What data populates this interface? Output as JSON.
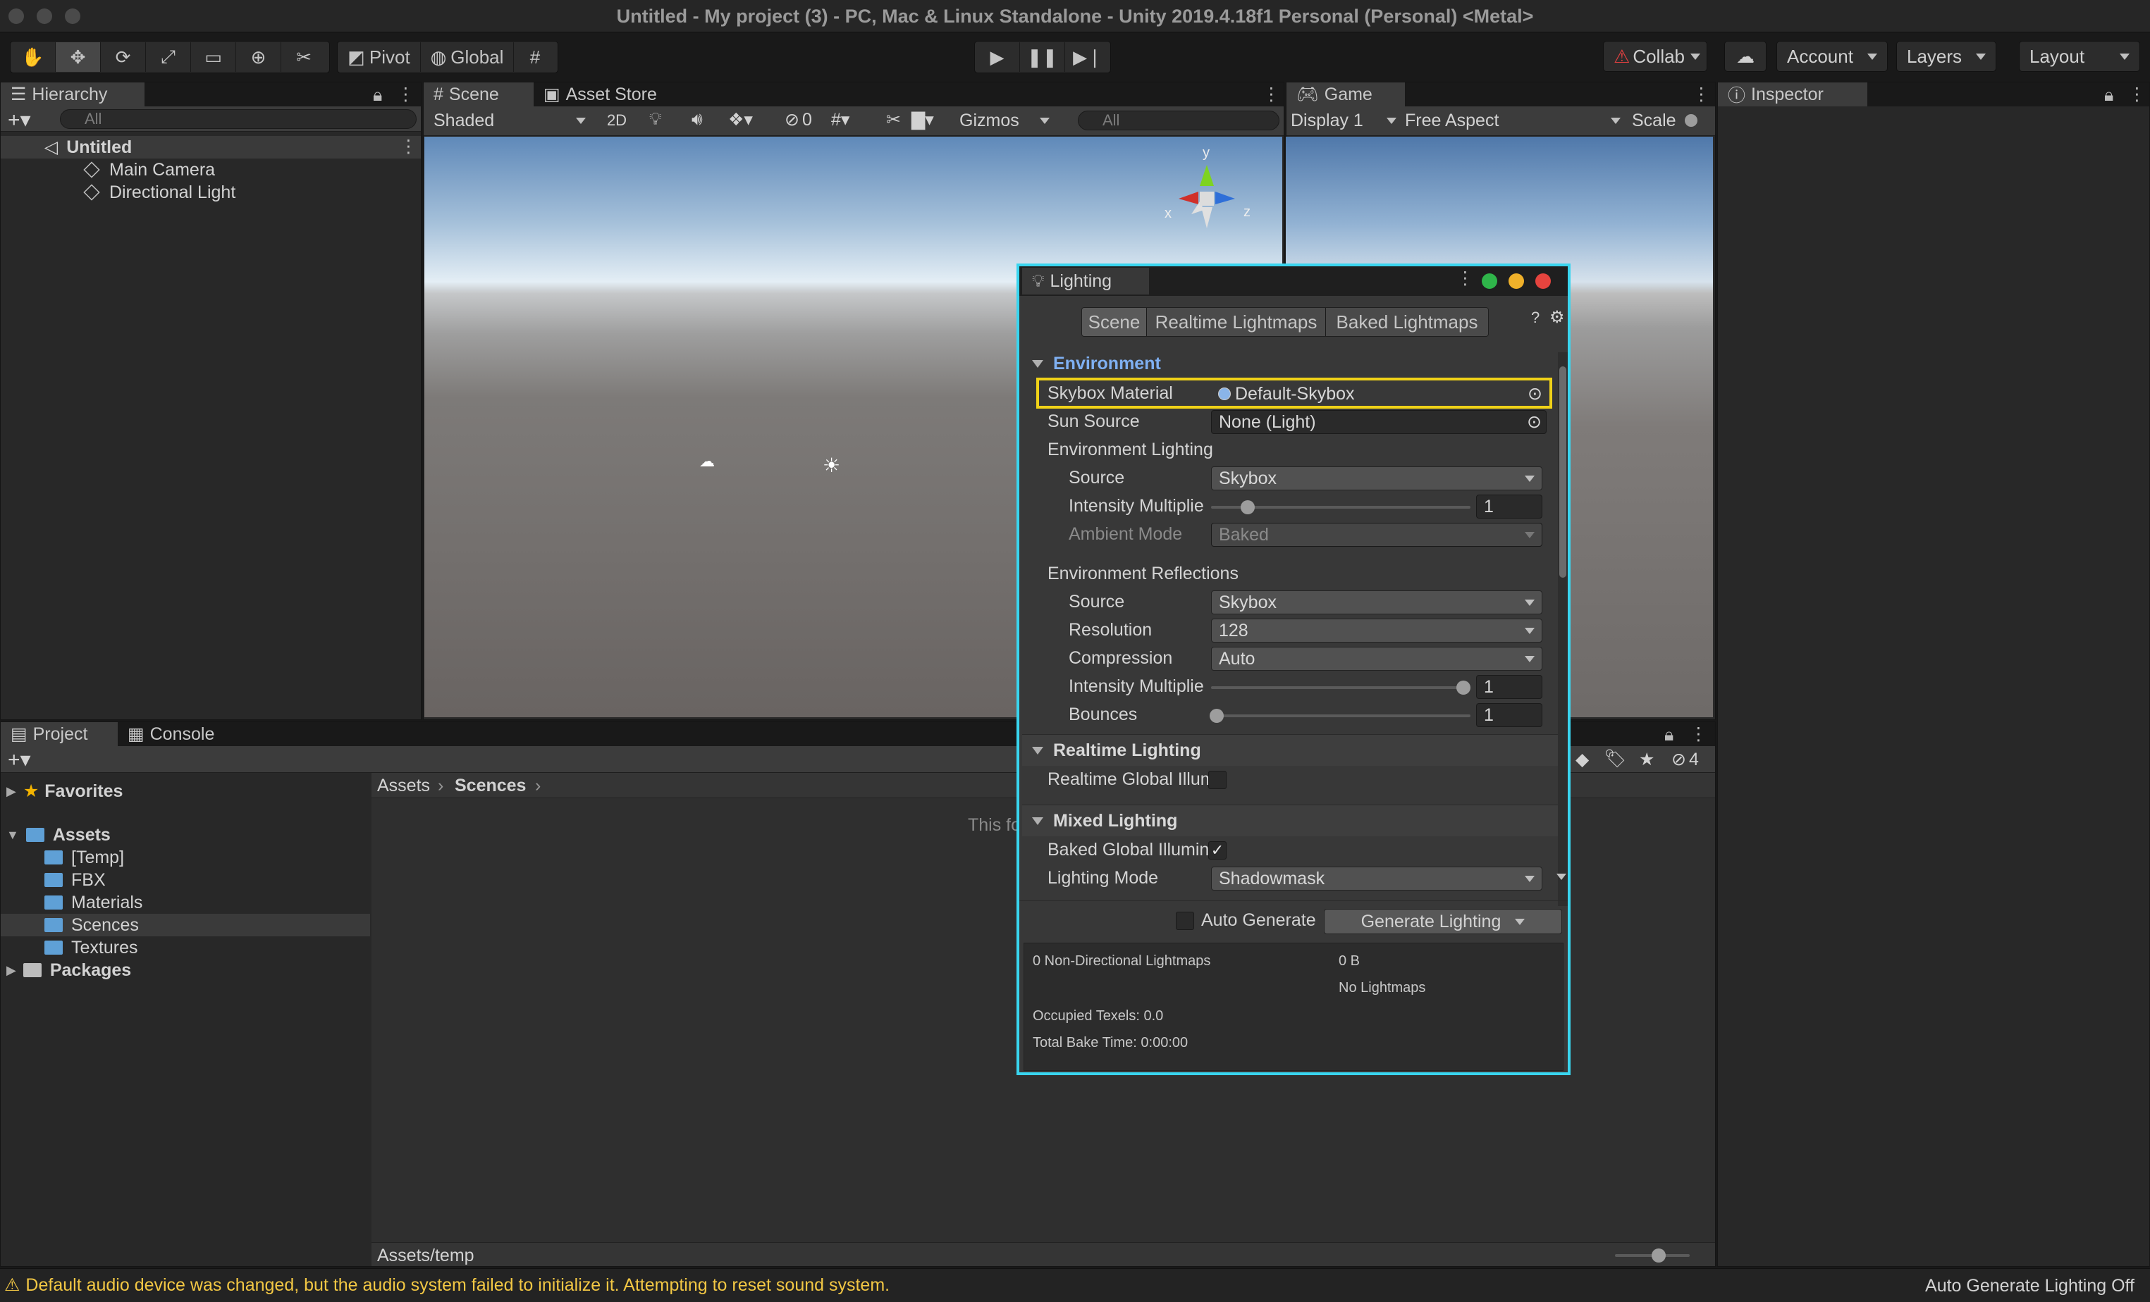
{
  "window": {
    "title": "Untitled - My project (3) - PC, Mac & Linux Standalone - Unity 2019.4.18f1 Personal (Personal) <Metal>"
  },
  "toolbar": {
    "pivot_label": "Pivot",
    "global_label": "Global",
    "collab_label": "Collab",
    "account_label": "Account",
    "layers_label": "Layers",
    "layout_label": "Layout"
  },
  "hierarchy": {
    "tab_label": "Hierarchy",
    "search_placeholder": "All",
    "scene_name": "Untitled",
    "items": [
      "Main Camera",
      "Directional Light"
    ]
  },
  "scene": {
    "tabs": [
      "Scene",
      "Asset Store"
    ],
    "shading_mode": "Shaded",
    "mode_2d": "2D",
    "hidden_count": "0",
    "gizmos_label": "Gizmos",
    "search_placeholder": "All",
    "axis_labels": {
      "x": "x",
      "y": "y",
      "z": "z"
    }
  },
  "game": {
    "tab_label": "Game",
    "display": "Display 1",
    "aspect": "Free Aspect",
    "scale_label": "Scale"
  },
  "inspector": {
    "tab_label": "Inspector"
  },
  "project": {
    "tabs": [
      "Project",
      "Console"
    ],
    "favorites_label": "Favorites",
    "assets_label": "Assets",
    "asset_folders": [
      "[Temp]",
      "FBX",
      "Materials",
      "Scences",
      "Textures"
    ],
    "packages_label": "Packages",
    "breadcrumb": [
      "Assets",
      "Scences"
    ],
    "empty_message": "This fo",
    "footer_path": "Assets/temp",
    "hidden_count": "4"
  },
  "lighting": {
    "title": "Lighting",
    "tabs": [
      "Scene",
      "Realtime Lightmaps",
      "Baked Lightmaps"
    ],
    "environment": {
      "header": "Environment",
      "skybox_label": "Skybox Material",
      "skybox_value": "Default-Skybox",
      "sun_label": "Sun Source",
      "sun_value": "None (Light)",
      "env_lighting_label": "Environment Lighting",
      "source_label": "Source",
      "source_value": "Skybox",
      "intensity_label": "Intensity Multiplie",
      "intensity_value": "1",
      "ambient_label": "Ambient Mode",
      "ambient_value": "Baked",
      "env_reflections_label": "Environment Reflections",
      "refl_source_label": "Source",
      "refl_source_value": "Skybox",
      "resolution_label": "Resolution",
      "resolution_value": "128",
      "compression_label": "Compression",
      "compression_value": "Auto",
      "refl_intensity_label": "Intensity Multiplie",
      "refl_intensity_value": "1",
      "bounces_label": "Bounces",
      "bounces_value": "1"
    },
    "realtime": {
      "header": "Realtime Lighting",
      "gi_label": "Realtime Global Illum"
    },
    "mixed": {
      "header": "Mixed Lighting",
      "baked_gi_label": "Baked Global Illumin",
      "mode_label": "Lighting Mode",
      "mode_value": "Shadowmask"
    },
    "auto_generate_label": "Auto Generate",
    "generate_label": "Generate Lighting",
    "stats": {
      "lightmaps": "0 Non-Directional Lightmaps",
      "size": "0 B",
      "no_lightmaps": "No Lightmaps",
      "occupied": "Occupied Texels: 0.0",
      "bake_time": "Total Bake Time: 0:00:00"
    }
  },
  "statusbar": {
    "warning": "Default audio device was changed, but the audio system failed to initialize it. Attempting to reset sound system.",
    "right": "Auto Generate Lighting Off"
  },
  "colors": {
    "accent_outline": "#39d5ef",
    "highlight_outline": "#f0d218",
    "warning": "#f2c744",
    "link_blue": "#7fb0f2"
  }
}
